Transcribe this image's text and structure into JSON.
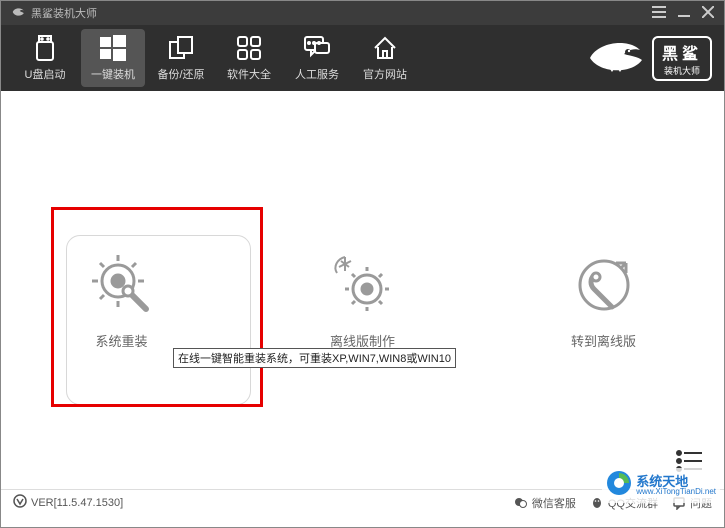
{
  "titlebar": {
    "title": "黑鲨装机大师"
  },
  "toolbar": {
    "items": [
      {
        "label": "U盘启动"
      },
      {
        "label": "一键装机"
      },
      {
        "label": "备份/还原"
      },
      {
        "label": "软件大全"
      },
      {
        "label": "人工服务"
      },
      {
        "label": "官方网站"
      }
    ]
  },
  "brand": {
    "line1": "黑鲨",
    "line2": "装机大师"
  },
  "main": {
    "cards": [
      {
        "label": "系统重装"
      },
      {
        "label": "离线版制作"
      },
      {
        "label": "转到离线版"
      }
    ],
    "tooltip": "在线一键智能重装系统，可重装XP,WIN7,WIN8或WIN10"
  },
  "statusbar": {
    "version": "VER[11.5.47.1530]",
    "links": {
      "wechat": "微信客服",
      "qq": "QQ交流群",
      "feedback": "问题"
    }
  },
  "watermark": {
    "line1": "系统天地",
    "line2": "www.XiTongTianDi.net"
  },
  "colors": {
    "accent": "#666",
    "danger": "#e60000"
  }
}
